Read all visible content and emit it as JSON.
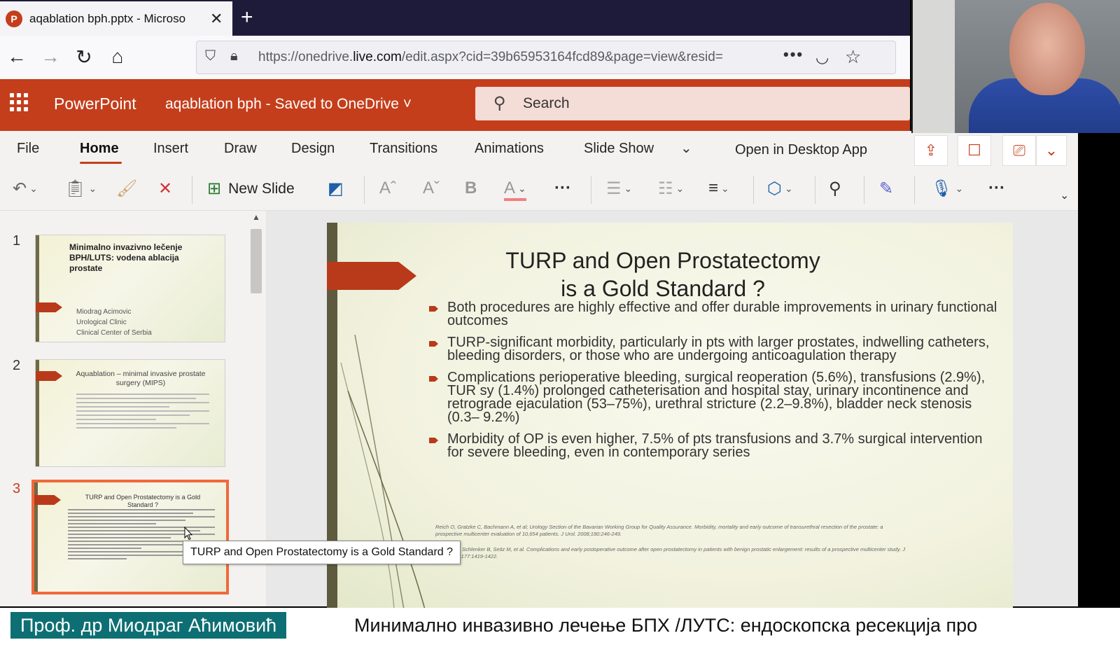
{
  "browser": {
    "tab_title": "aqablation bph.pptx - Microso",
    "tab_favicon": "P",
    "new_tab": "+",
    "url_prefix": "https://onedrive.",
    "url_domain": "live.com",
    "url_suffix": "/edit.aspx?cid=39b65953164fcd89&page=view&resid="
  },
  "app": {
    "name": "PowerPoint",
    "doc_title": "aqablation bph  -  Saved to OneDrive ˅",
    "search_placeholder": "Search",
    "accent_color": "#c43e1c"
  },
  "ribbon": {
    "tabs": [
      "File",
      "Home",
      "Insert",
      "Draw",
      "Design",
      "Transitions",
      "Animations",
      "Slide Show"
    ],
    "active_tab": "Home",
    "open_desktop": "Open in Desktop App",
    "new_slide": "New Slide"
  },
  "thumbnails": [
    {
      "number": "1",
      "title": "Minimalno invazivno lečenje BPH/LUTS: vodena ablacija prostate",
      "author_lines": [
        "Miodrag Acimovic",
        "Urological Clinic",
        "Clinical Center of Serbia"
      ]
    },
    {
      "number": "2",
      "title": "Aquablation – minimal invasive prostate surgery (MIPS)"
    },
    {
      "number": "3",
      "title": "TURP and Open Prostatectomy is a Gold Standard ?"
    }
  ],
  "tooltip": "TURP and Open Prostatectomy is a Gold Standard ?",
  "slide": {
    "title_line1": "TURP and Open Prostatectomy",
    "title_line2": "is a Gold Standard ?",
    "bullets": [
      "Both procedures are highly effective and offer durable improvements in urinary functional outcomes",
      "TURP-significant morbidity, particularly in pts with larger prostates, indwelling catheters, bleeding disorders, or those who are undergoing anticoagulation therapy",
      "Complications perioperative bleeding, surgical reoperation (5.6%), transfusions (2.9%), TUR sy (1.4%) prolonged catheterisation and hospital stay, urinary incontinence and retrograde ejaculation (53–75%), urethral stricture (2.2–9.8%), bladder neck stenosis (0.3– 9.2%)",
      "Morbidity of OP is even higher, 7.5% of pts  transfusions and 3.7% surgical intervention for severe bleeding, even in contemporary series"
    ],
    "references": [
      "Reich O, Gratzke C, Bachmann A, et al; Urology Section of the Bavarian Working Group for Quality Assurance. Morbidity, mortality and early outcome of transurethral resection of the prostate: a prospective multicenter evaluation of 10,654 patients. J Urol. 2008;180:246-249.",
      "Gratzke C, Schlenker B, Seitz M, et al. Complications and early postoperative outcome after open prostatectomy in patients with benign prostatic enlargement: results of a prospective multicenter study. J Urol. 2007;177:1419-1422."
    ]
  },
  "caption": {
    "name": "Проф. др Миодраг Аћимовић",
    "text": "Минимално инвазивно лечење БПХ /ЛУТС: ендоскопска ресекција про"
  }
}
